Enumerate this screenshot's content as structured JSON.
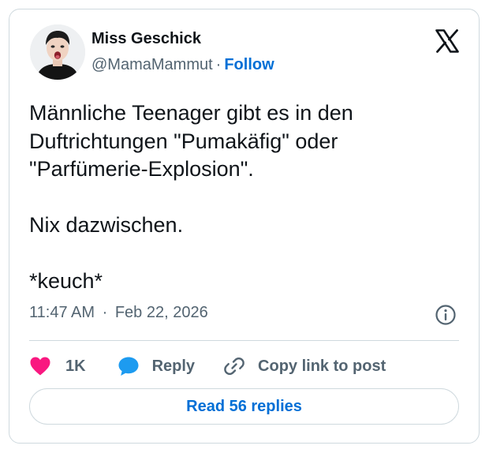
{
  "author": {
    "display_name": "Miss Geschick",
    "handle": "@MamaMammut",
    "separator": "·",
    "follow_label": "Follow",
    "avatar_icon": "avatar-photo"
  },
  "tweet": {
    "text": "Männliche Teenager gibt es in den\nDuftrichtungen \"Pumakäfig\" oder\n\"Parfümerie-Explosion\".\n\nNix dazwischen.\n\n*keuch*",
    "time": "11:47 AM",
    "separator": "·",
    "date": "Feb 22, 2026"
  },
  "actions": {
    "like_count": "1K",
    "reply_label": "Reply",
    "copy_label": "Copy link to post"
  },
  "read_replies_label": "Read 56 replies",
  "colors": {
    "text": "#0f1419",
    "muted": "#536471",
    "link": "#006fd6",
    "heart": "#f91880",
    "reply_bubble": "#1d9bf0",
    "border": "#cfd9de"
  },
  "icons": [
    "x-logo-icon",
    "info-icon",
    "heart-icon",
    "reply-bubble-icon",
    "link-icon"
  ]
}
